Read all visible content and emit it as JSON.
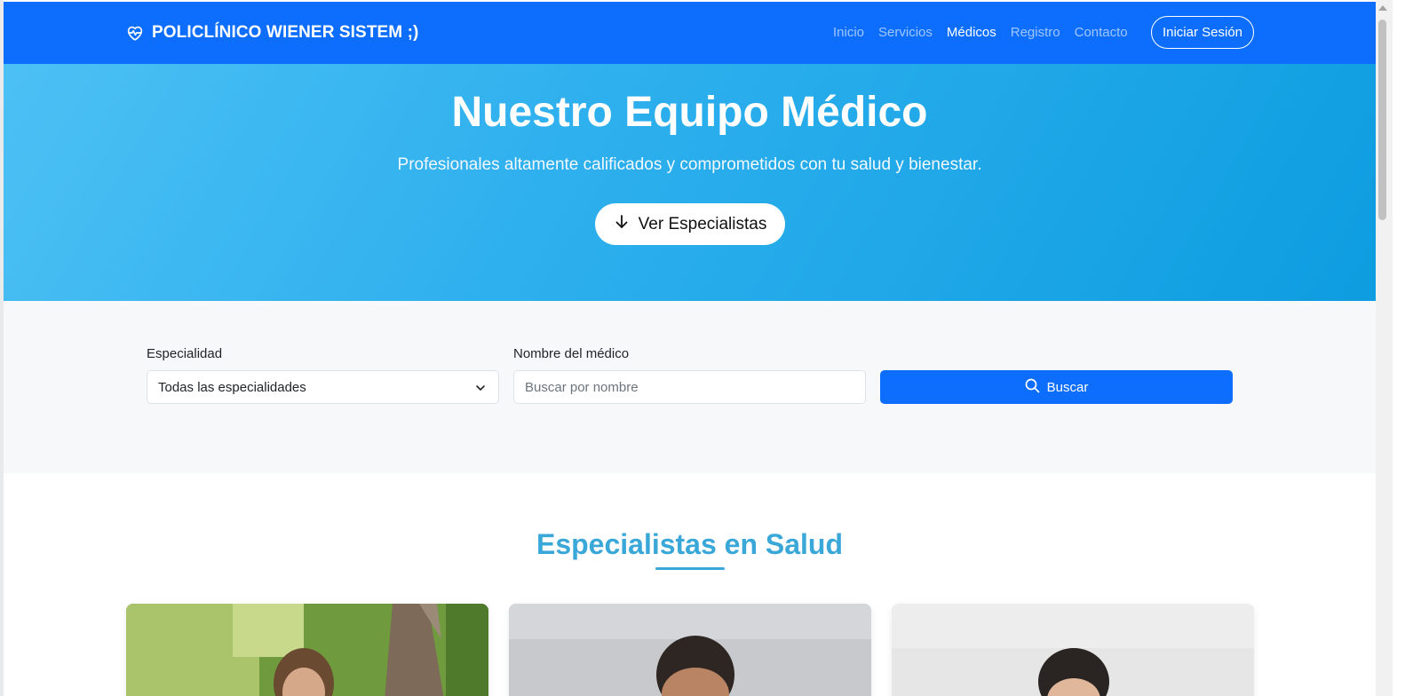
{
  "navbar": {
    "brand": "POLICLÍNICO WIENER SISTEM ;)",
    "brand_icon": "heart-pulse-icon",
    "links": [
      {
        "label": "Inicio",
        "active": false
      },
      {
        "label": "Servicios",
        "active": false
      },
      {
        "label": "Médicos",
        "active": true
      },
      {
        "label": "Registro",
        "active": false
      },
      {
        "label": "Contacto",
        "active": false
      }
    ],
    "login_label": "Iniciar Sesión"
  },
  "hero": {
    "title": "Nuestro Equipo Médico",
    "subtitle": "Profesionales altamente calificados y comprometidos con tu salud y bienestar.",
    "button_label": "Ver Especialistas",
    "button_icon": "arrow-down-icon"
  },
  "search": {
    "specialty_label": "Especialidad",
    "specialty_value": "Todas las especialidades",
    "name_label": "Nombre del médico",
    "name_placeholder": "Buscar por nombre",
    "button_label": "Buscar",
    "button_icon": "search-icon"
  },
  "specialists": {
    "title": "Especialistas en Salud",
    "cards": [
      {
        "photo": "doctor-photo-woman-outdoor"
      },
      {
        "photo": "doctor-photo-man"
      },
      {
        "photo": "doctor-photo-woman"
      }
    ]
  },
  "colors": {
    "primary": "#0d6efd",
    "hero_start": "#4cc0f4",
    "hero_end": "#0d9de0",
    "accent": "#3aa7d9",
    "section_bg": "#f7f8fa"
  }
}
